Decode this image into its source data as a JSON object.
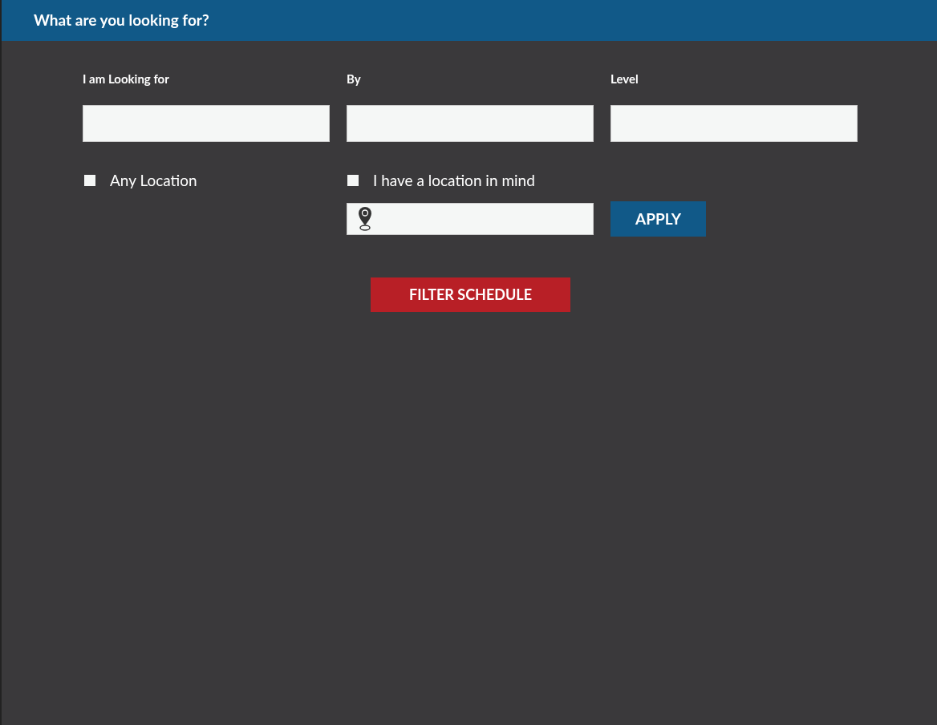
{
  "header": {
    "title": "What are you looking for?"
  },
  "fields": [
    {
      "label": "I am Looking for"
    },
    {
      "label": "By"
    },
    {
      "label": "Level"
    }
  ],
  "location_options": [
    {
      "label": "Any Location",
      "checked": false
    },
    {
      "label": "I have a location in mind",
      "checked": false
    }
  ],
  "apply_button": "APPLY",
  "filter_button": "FILTER SCHEDULE"
}
